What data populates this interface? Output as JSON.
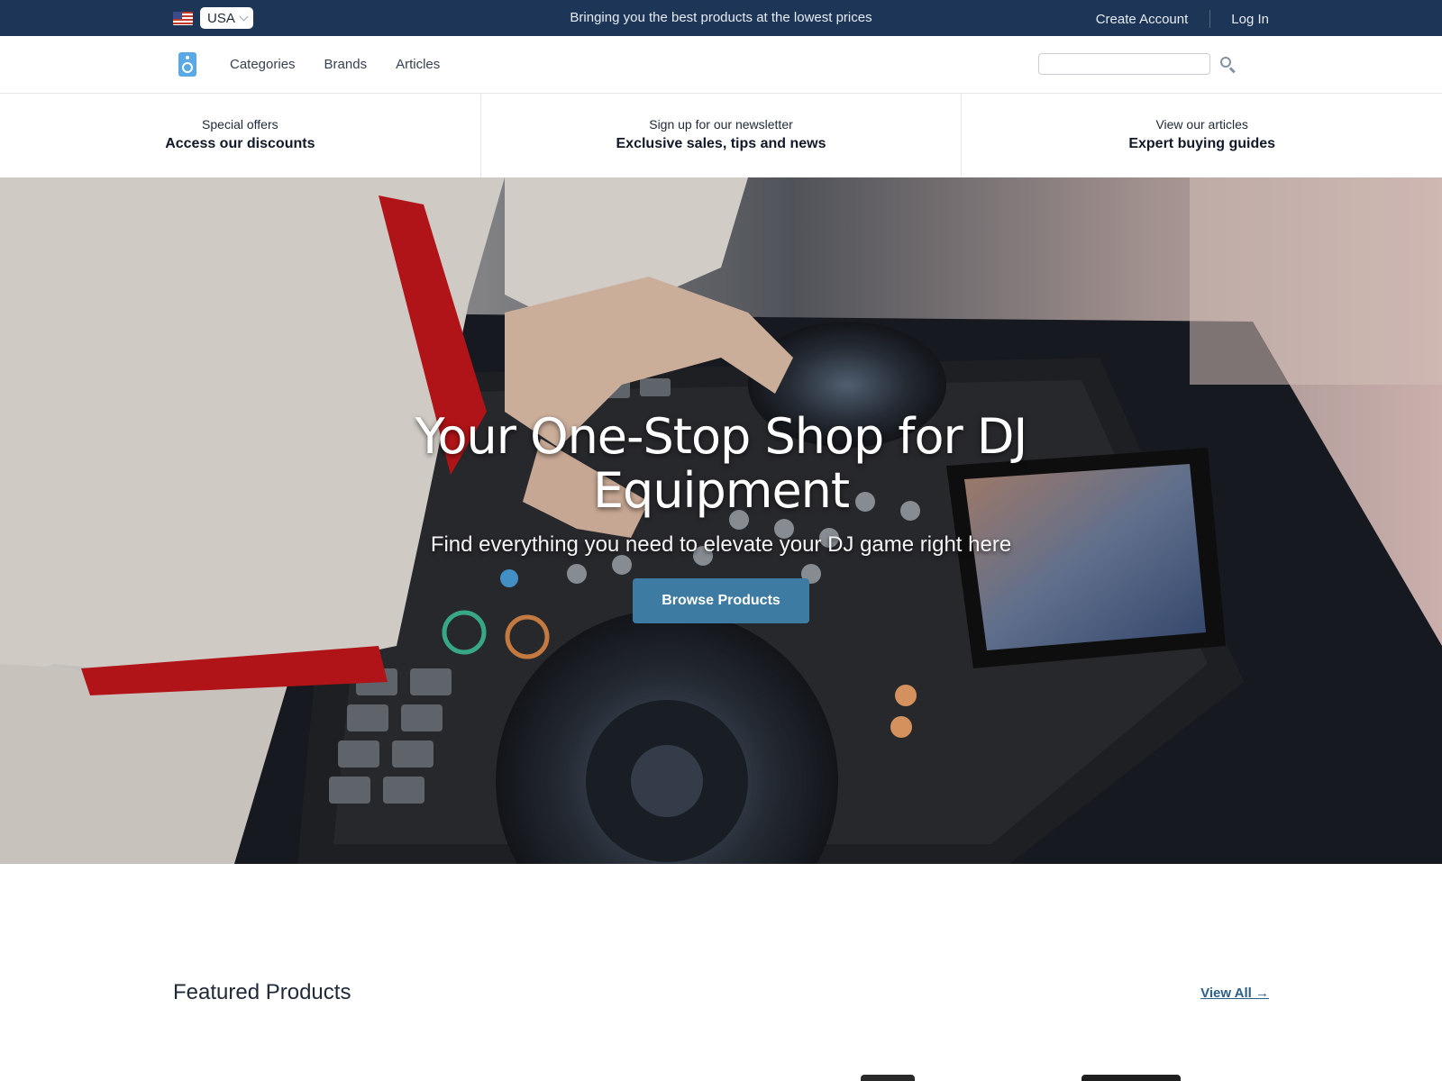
{
  "topbar": {
    "country": "USA",
    "tagline": "Bringing you the best products at the lowest prices",
    "create_account": "Create Account",
    "log_in": "Log In"
  },
  "nav": {
    "links": [
      "Categories",
      "Brands",
      "Articles"
    ],
    "search_placeholder": ""
  },
  "promos": [
    {
      "small": "Special offers",
      "big": "Access our discounts"
    },
    {
      "small": "Sign up for our newsletter",
      "big": "Exclusive sales, tips and news"
    },
    {
      "small": "View our articles",
      "big": "Expert buying guides"
    }
  ],
  "hero": {
    "title": "Your One-Stop Shop for DJ Equipment",
    "subtitle": "Find everything you need to elevate your DJ game right here",
    "button": "Browse Products"
  },
  "featured": {
    "title": "Featured Products",
    "view_all": "View All →"
  },
  "colors": {
    "topbar_bg": "#1d3557",
    "accent_button": "#3d7ba3",
    "link": "#2c5f8a",
    "logo": "#5aa9e6"
  }
}
